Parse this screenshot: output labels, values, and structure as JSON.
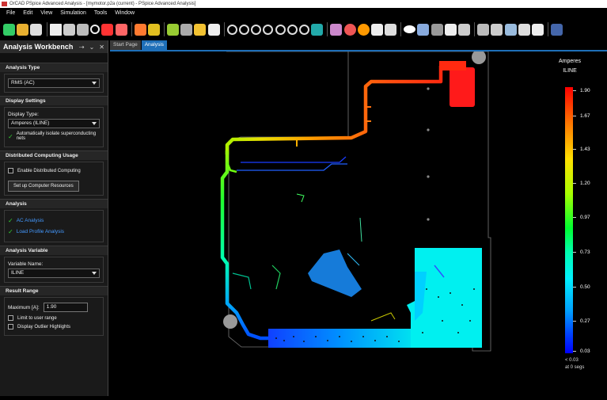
{
  "window": {
    "title": "OrCAD PSpice Advanced Analysis - [mymotor.p2a (current) - PSpice Advanced Analysis]"
  },
  "menu": [
    "File",
    "Edit",
    "View",
    "Simulation",
    "Tools",
    "Window"
  ],
  "panel": {
    "title": "Analysis Workbench",
    "analysis_type": {
      "heading": "Analysis Type",
      "value": "RMS (AC)"
    },
    "display_settings": {
      "heading": "Display Settings",
      "display_type_label": "Display Type:",
      "display_type_value": "Amperes (ILINE)",
      "auto_isolate_label": "Automatically isolate superconducting nets"
    },
    "distributed": {
      "heading": "Distributed Computing Usage",
      "enable_label": "Enable Distributed Computing",
      "setup_button": "Set up Computer Resources"
    },
    "analysis": {
      "heading": "Analysis",
      "items": [
        "AC Analysis",
        "Load Profile Analysis"
      ]
    },
    "analysis_variable": {
      "heading": "Analysis Variable",
      "variable_label": "Variable Name:",
      "variable_value": "ILINE"
    },
    "result_range": {
      "heading": "Result Range",
      "maximum_label": "Maximum [A]:",
      "maximum_value": "1.90",
      "limit_label": "Limit to user range",
      "outlier_label": "Display Outlier Highlights"
    }
  },
  "tabs": [
    {
      "label": "Start Page"
    },
    {
      "label": "Analysis"
    }
  ],
  "legend": {
    "title": "Amperes",
    "subtitle": "ILINE",
    "ticks": [
      "1.90",
      "1.67",
      "1.43",
      "1.20",
      "0.97",
      "0.73",
      "0.50",
      "0.27",
      "0.03"
    ],
    "below_line1": "< 0.03",
    "below_line2": "at 0 segs"
  },
  "colors": {
    "accent": "#1e6fb8",
    "check": "#33cc33",
    "analysis_link": "#4499ff"
  }
}
